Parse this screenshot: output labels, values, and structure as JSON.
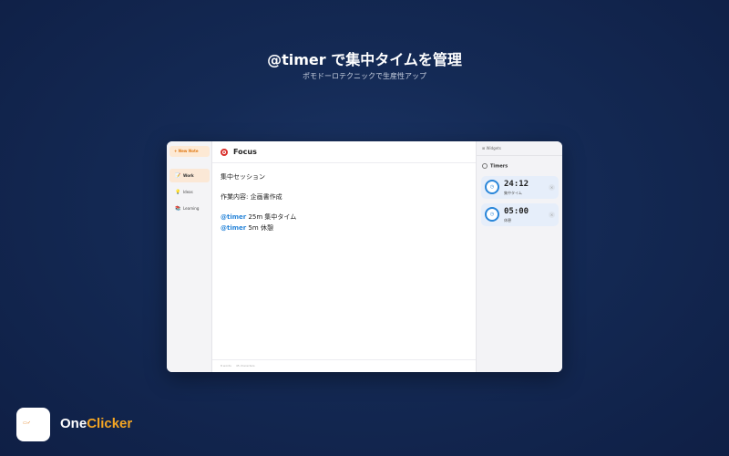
{
  "hero": {
    "title": "@timer で集中タイムを管理",
    "subtitle": "ポモドーロテクニックで生産性アップ"
  },
  "sidebar": {
    "new_note": "New Note",
    "items": [
      {
        "label": "Work",
        "icon": "memo-icon",
        "active": true
      },
      {
        "label": "Ideas",
        "icon": "lightbulb-icon",
        "active": false
      },
      {
        "label": "Learning",
        "icon": "books-icon",
        "active": false
      }
    ]
  },
  "editor": {
    "title": "Focus",
    "lines": [
      "集中セッション",
      "作業内容: 企画書作成"
    ],
    "timer_lines": [
      {
        "mention": "@timer",
        "text": " 25m 集中タイム"
      },
      {
        "mention": "@timer",
        "text": " 5m 休憩"
      }
    ],
    "word_count": "8 words",
    "char_count": "45 characters"
  },
  "widgets": {
    "header": "Widgets",
    "timers_title": "Timers",
    "timers": [
      {
        "time": "24:12",
        "label": "集中タイム"
      },
      {
        "time": "05:00",
        "label": "休憩"
      }
    ]
  },
  "brand": {
    "one": "One",
    "clicker": "Clicker"
  },
  "colors": {
    "accent": "#2a86d9",
    "brand_orange": "#f5a623",
    "new_note_orange": "#e07b17"
  }
}
